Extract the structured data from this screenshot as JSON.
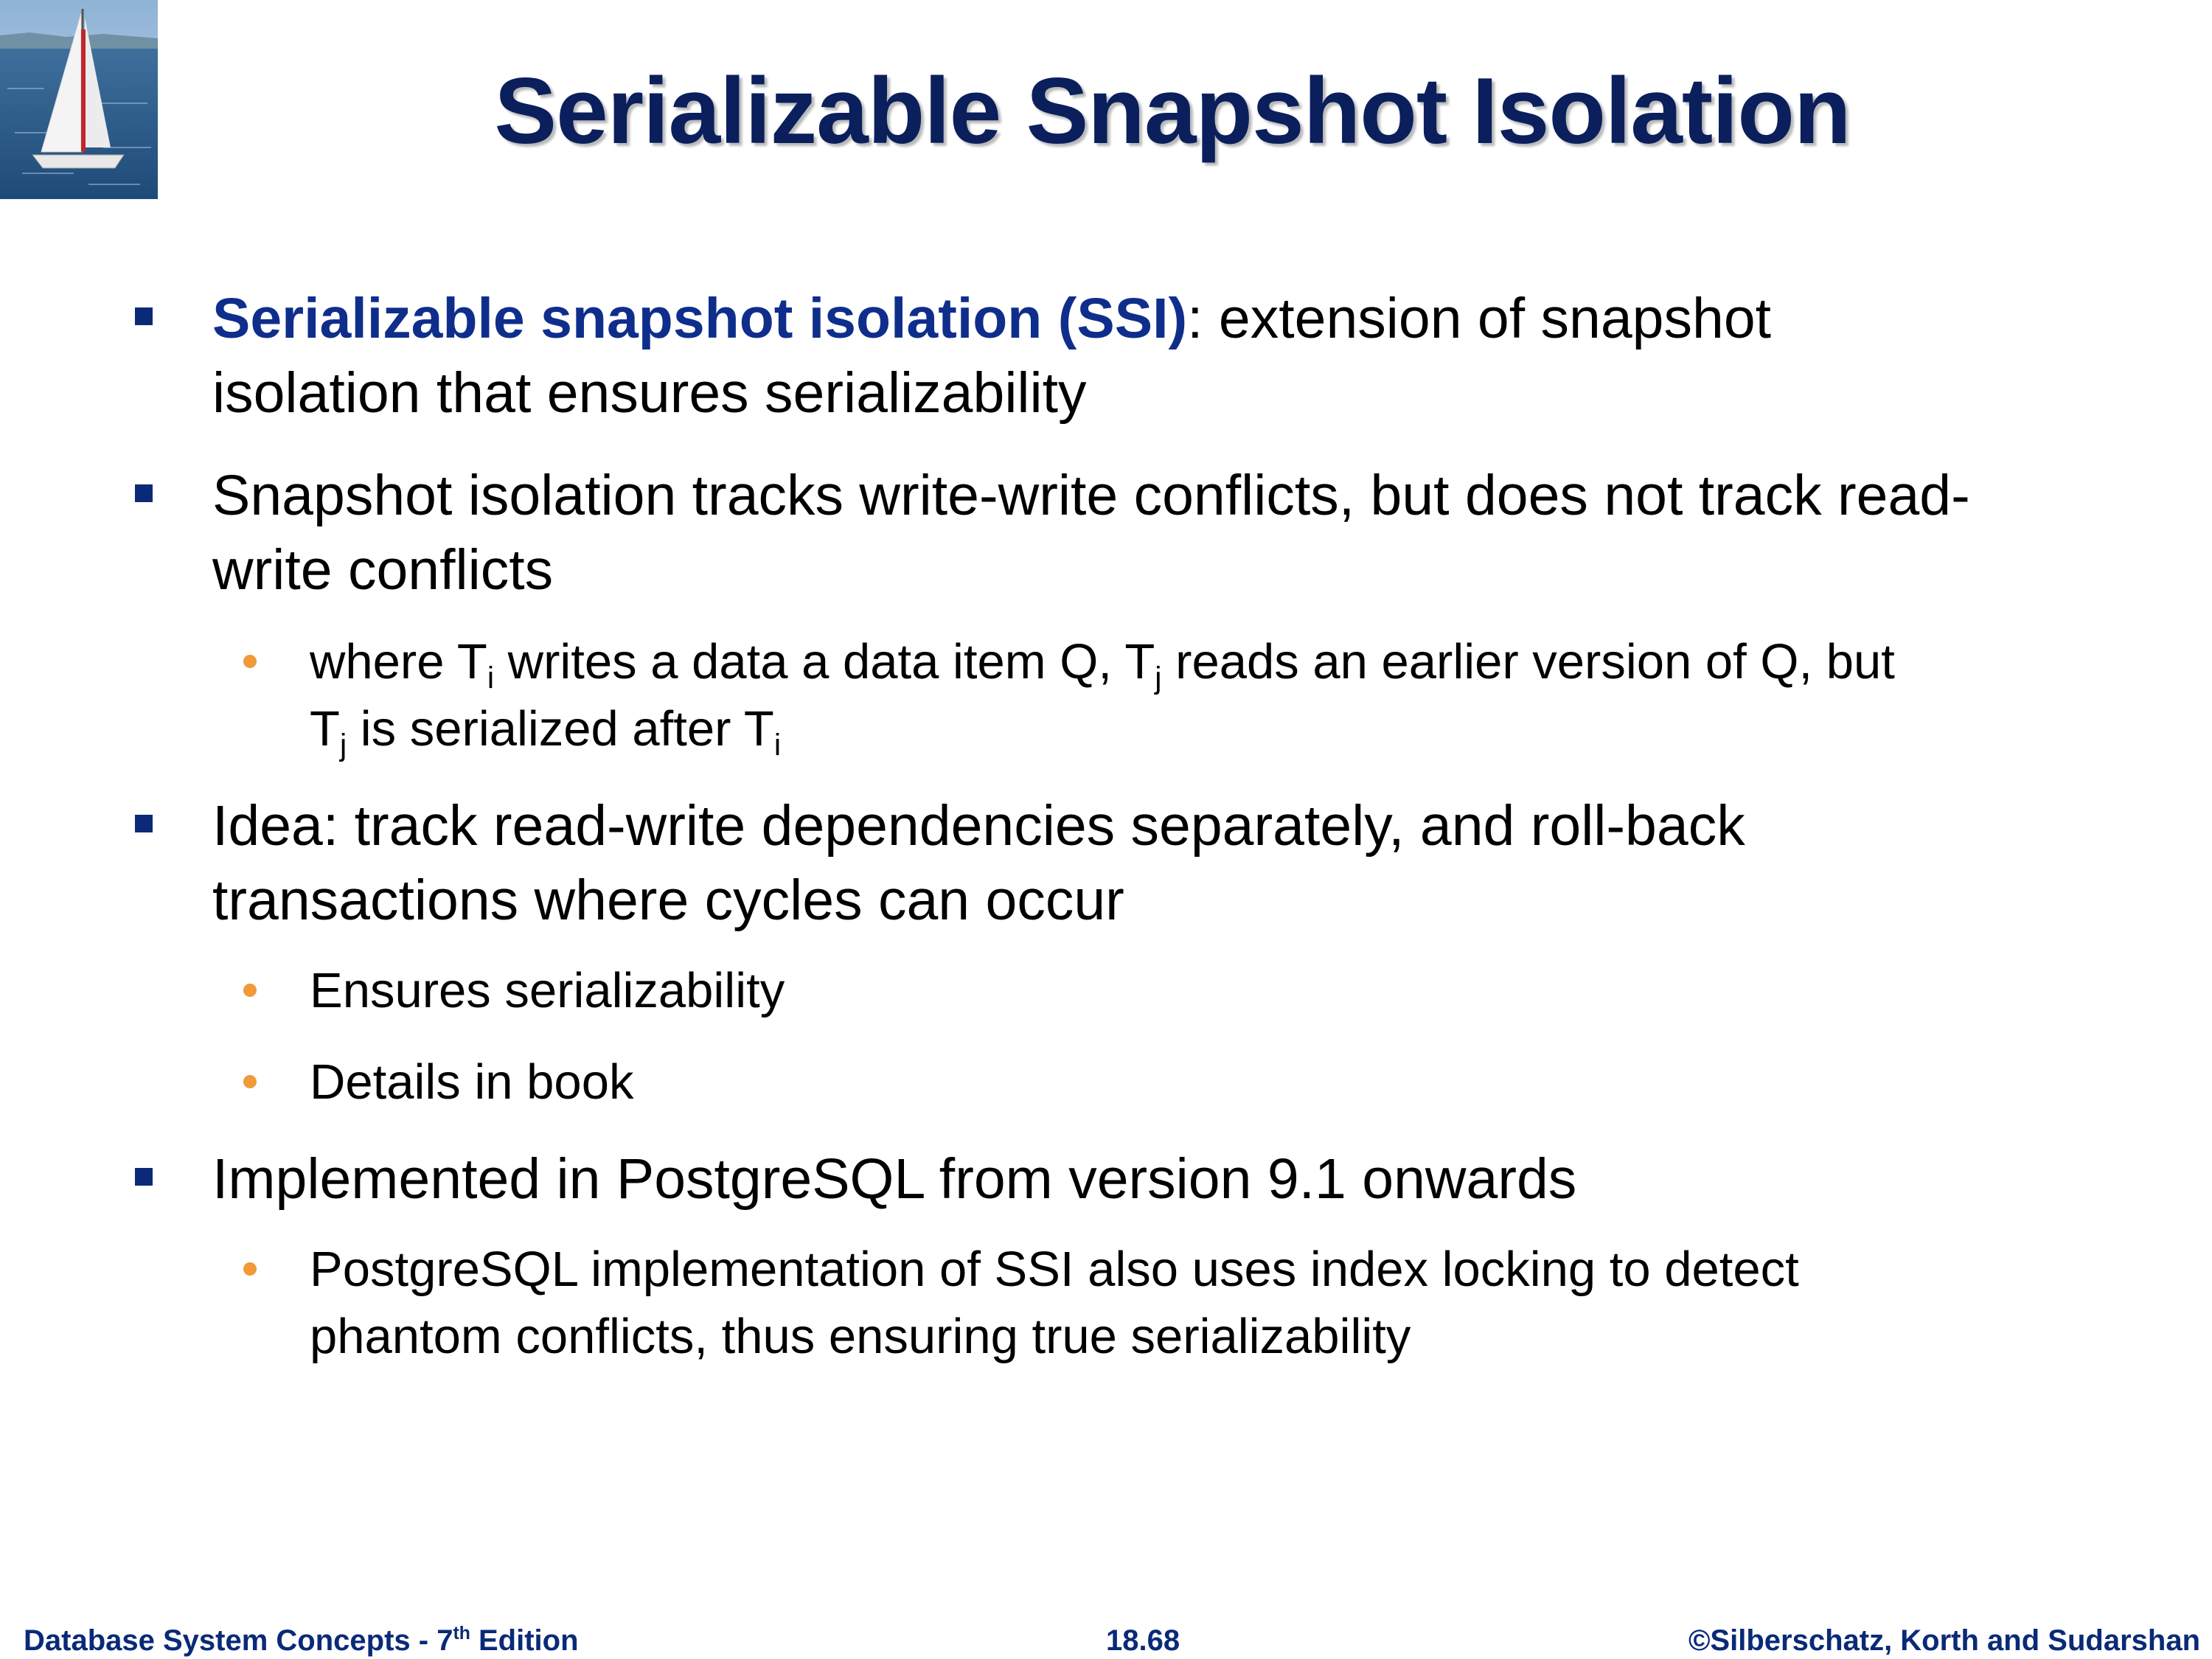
{
  "title": "Serializable Snapshot Isolation",
  "colors": {
    "title": "#0a1f5c",
    "emphasis": "#0f2e8c",
    "square_bullet": "#0a2a78",
    "round_bullet": "#f09a3a",
    "footer": "#0a2a78"
  },
  "logo_icon": "sailboat-photo-icon",
  "bullets": [
    {
      "emphasis": "Serializable snapshot isolation (SSI)",
      "text_line1": ": extension of snapshot",
      "text_line2": "isolation that ensures serializability"
    },
    {
      "line1": "Snapshot isolation tracks write-write conflicts, but does not track read-",
      "line2": "write conflicts",
      "sub": {
        "t1": "where T",
        "s1": "i",
        "t2": " writes a data a data item Q, T",
        "s2": "j",
        "t3": " reads an earlier version of Q, but",
        "t4": "T",
        "s4": "j",
        "t5": " is serialized after T",
        "s5": "i"
      }
    },
    {
      "line1": "Idea:  track read-write dependencies separately, and roll-back",
      "line2": "transactions where cycles can occur",
      "subs": [
        "Ensures serializability",
        "Details in book"
      ]
    },
    {
      "line1": "Implemented in PostgreSQL from version 9.1 onwards",
      "sub_line1": "PostgreSQL implementation of SSI also uses index locking to detect",
      "sub_line2": "phantom conflicts, thus ensuring true serializability"
    }
  ],
  "footer": {
    "left": "Database System Concepts - 7",
    "left_sup": "th",
    "left_tail": " Edition",
    "center": "18.68",
    "right": "©Silberschatz, Korth and Sudarshan"
  }
}
